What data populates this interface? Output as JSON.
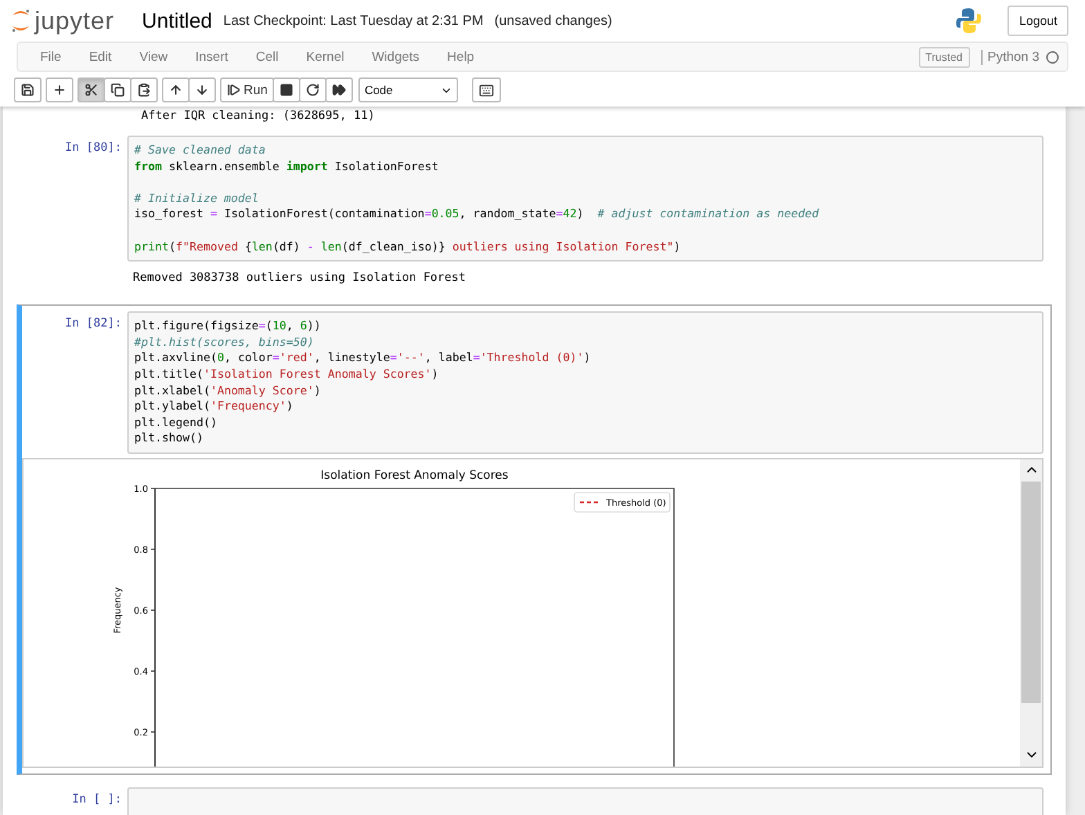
{
  "header": {
    "logo_text": "jupyter",
    "title": "Untitled",
    "checkpoint": "Last Checkpoint: Last Tuesday at 2:31 PM",
    "status": "(unsaved changes)",
    "logout": "Logout"
  },
  "menu": {
    "items": [
      "File",
      "Edit",
      "View",
      "Insert",
      "Cell",
      "Kernel",
      "Widgets",
      "Help"
    ],
    "trusted": "Trusted",
    "kernel": "Python 3",
    "kernel_busy": false
  },
  "toolbar": {
    "buttons": [
      {
        "kind": "save",
        "pressed": false
      },
      {
        "kind": "add",
        "pressed": false
      },
      {
        "kind": "cut",
        "pressed": true
      },
      {
        "kind": "copy",
        "pressed": false
      },
      {
        "kind": "paste",
        "pressed": false
      },
      {
        "kind": "up",
        "pressed": false
      },
      {
        "kind": "down",
        "pressed": false
      },
      {
        "kind": "run",
        "label": "Run",
        "pressed": false
      },
      {
        "kind": "stop",
        "pressed": false
      },
      {
        "kind": "restart",
        "pressed": false
      },
      {
        "kind": "runall",
        "pressed": false
      }
    ],
    "cell_type": "Code"
  },
  "prior_output": "After IQR cleaning: (3628695, 11)",
  "cells": [
    {
      "prompt": "In [80]:",
      "selected": false,
      "lines": [
        [
          {
            "kind": "comment",
            "text": "# Save cleaned data"
          }
        ],
        [
          {
            "kind": "keyword",
            "text": "from"
          },
          {
            "kind": "plain",
            "text": " sklearn.ensemble "
          },
          {
            "kind": "keyword",
            "text": "import"
          },
          {
            "kind": "plain",
            "text": " IsolationForest"
          }
        ],
        [
          {
            "kind": "blank"
          }
        ],
        [
          {
            "kind": "comment",
            "text": "# Initialize model"
          }
        ],
        [
          {
            "kind": "plain",
            "text": "iso_forest "
          },
          {
            "kind": "operator",
            "text": "="
          },
          {
            "kind": "plain",
            "text": " IsolationForest(contamination"
          },
          {
            "kind": "operator",
            "text": "="
          },
          {
            "kind": "number",
            "text": "0.05"
          },
          {
            "kind": "plain",
            "text": ", random_state"
          },
          {
            "kind": "operator",
            "text": "="
          },
          {
            "kind": "number",
            "text": "42"
          },
          {
            "kind": "plain",
            "text": ")  "
          },
          {
            "kind": "comment",
            "text": "# adjust contamination as needed"
          }
        ],
        [
          {
            "kind": "blank"
          }
        ],
        [
          {
            "kind": "builtin",
            "text": "print"
          },
          {
            "kind": "plain",
            "text": "("
          },
          {
            "kind": "string",
            "text": "f\"Removed "
          },
          {
            "kind": "plain",
            "text": "{"
          },
          {
            "kind": "builtin",
            "text": "len"
          },
          {
            "kind": "plain",
            "text": "(df) "
          },
          {
            "kind": "operator",
            "text": "- "
          },
          {
            "kind": "builtin",
            "text": "len"
          },
          {
            "kind": "plain",
            "text": "(df_clean_iso)}"
          },
          {
            "kind": "string",
            "text": " outliers using Isolation Forest\""
          },
          {
            "kind": "plain",
            "text": ")"
          }
        ]
      ],
      "output": {
        "kind": "text",
        "text": "Removed 3083738 outliers using Isolation Forest"
      }
    },
    {
      "prompt": "In [82]:",
      "selected": true,
      "lines": [
        [
          {
            "kind": "plain",
            "text": "plt.figure(figsize"
          },
          {
            "kind": "operator",
            "text": "="
          },
          {
            "kind": "plain",
            "text": "("
          },
          {
            "kind": "number",
            "text": "10"
          },
          {
            "kind": "plain",
            "text": ", "
          },
          {
            "kind": "number",
            "text": "6"
          },
          {
            "kind": "plain",
            "text": "))"
          }
        ],
        [
          {
            "kind": "comment",
            "text": "#plt.hist(scores, bins=50)"
          }
        ],
        [
          {
            "kind": "plain",
            "text": "plt.axvline("
          },
          {
            "kind": "number",
            "text": "0"
          },
          {
            "kind": "plain",
            "text": ", color"
          },
          {
            "kind": "operator",
            "text": "="
          },
          {
            "kind": "string",
            "text": "'red'"
          },
          {
            "kind": "plain",
            "text": ", linestyle"
          },
          {
            "kind": "operator",
            "text": "="
          },
          {
            "kind": "string",
            "text": "'--'"
          },
          {
            "kind": "plain",
            "text": ", label"
          },
          {
            "kind": "operator",
            "text": "="
          },
          {
            "kind": "string",
            "text": "'Threshold (0)'"
          },
          {
            "kind": "plain",
            "text": ")"
          }
        ],
        [
          {
            "kind": "plain",
            "text": "plt.title("
          },
          {
            "kind": "string",
            "text": "'Isolation Forest Anomaly Scores'"
          },
          {
            "kind": "plain",
            "text": ")"
          }
        ],
        [
          {
            "kind": "plain",
            "text": "plt.xlabel("
          },
          {
            "kind": "string",
            "text": "'Anomaly Score'"
          },
          {
            "kind": "plain",
            "text": ")"
          }
        ],
        [
          {
            "kind": "plain",
            "text": "plt.ylabel("
          },
          {
            "kind": "string",
            "text": "'Frequency'"
          },
          {
            "kind": "plain",
            "text": ")"
          }
        ],
        [
          {
            "kind": "plain",
            "text": "plt.legend()"
          }
        ],
        [
          {
            "kind": "plain",
            "text": "plt.show()"
          }
        ]
      ],
      "output": {
        "kind": "chart",
        "chart_data": {
          "type": "line",
          "title": "Isolation Forest Anomaly Scores",
          "ylabel": "Frequency",
          "ylim": [
            0,
            1
          ],
          "yticks": [
            {
              "value": 1,
              "label": "1.0"
            },
            {
              "value": 0.8,
              "label": "0.8"
            },
            {
              "value": 0.6,
              "label": "0.6"
            },
            {
              "value": 0.4,
              "label": "0.4"
            },
            {
              "value": 0.2,
              "label": "0.2"
            }
          ],
          "series": [
            {
              "name": "Threshold (0)",
              "color": "#d62728"
            }
          ]
        }
      }
    },
    {
      "prompt": "In [ ]:",
      "selected": false
    }
  ]
}
